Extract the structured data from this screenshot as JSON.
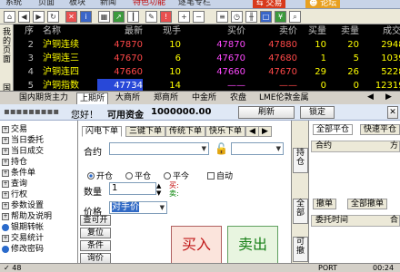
{
  "menu": {
    "items": [
      "系统",
      "页面",
      "板块",
      "新闻",
      "特色功能",
      "逐笔专栏"
    ],
    "trade": "交易",
    "forum": "论坛"
  },
  "side_strip": {
    "top": [
      "我",
      "的",
      "页",
      "面"
    ],
    "bottom": [
      "国",
      "内"
    ]
  },
  "quote_table": {
    "headers": {
      "seq": "序",
      "name": "名称",
      "last": "最新",
      "vol": "现手",
      "bid": "买价",
      "ask": "卖价",
      "bidq": "买量",
      "askq": "卖量",
      "total": "成交量"
    },
    "rows": [
      {
        "seq": "2",
        "name": "沪铜连续",
        "last": "47870",
        "vol": "10",
        "bid": "47870",
        "ask": "47880",
        "bidq": "10",
        "askq": "20",
        "total": "29482"
      },
      {
        "seq": "3",
        "name": "沪铜连三",
        "last": "47670",
        "vol": "6",
        "bid": "47670",
        "ask": "47680",
        "bidq": "1",
        "askq": "5",
        "total": "10398"
      },
      {
        "seq": "4",
        "name": "沪铜连四",
        "last": "47660",
        "vol": "10",
        "bid": "47660",
        "ask": "47670",
        "bidq": "29",
        "askq": "26",
        "total": "52288"
      },
      {
        "seq": "5",
        "name": "沪铜指数",
        "last": "47734",
        "vol": "14",
        "bid": "——",
        "ask": "——",
        "bidq": "0",
        "askq": "0",
        "total": "123190"
      }
    ]
  },
  "market_tabs": [
    "国内期货主力",
    "上期所",
    "大商所",
    "郑商所",
    "中金所",
    "农盘",
    "LME伦敦金属"
  ],
  "market_tabs_active": "上期所",
  "account": {
    "greeting": "您好！",
    "funds_label": "可用资金",
    "funds_value": "1000000.00",
    "refresh": "刷新",
    "lock": "锁定"
  },
  "tree": [
    {
      "icon": "+",
      "label": "交易"
    },
    {
      "icon": "+",
      "label": "当日委托"
    },
    {
      "icon": "+",
      "label": "当日成交"
    },
    {
      "icon": "+",
      "label": "持仓"
    },
    {
      "icon": "+",
      "label": "条件单"
    },
    {
      "icon": "+",
      "label": "查询"
    },
    {
      "icon": "+",
      "label": "行权"
    },
    {
      "icon": "+",
      "label": "参数设置"
    },
    {
      "icon": "+",
      "label": "帮助及说明"
    },
    {
      "icon": "dot",
      "label": "银期转帐"
    },
    {
      "icon": "+",
      "label": "交易统计"
    },
    {
      "icon": "dot",
      "label": "修改密码"
    }
  ],
  "order": {
    "tabs": [
      "闪电下单",
      "三键下单",
      "传统下单",
      "快乐下单"
    ],
    "contract_label": "合约",
    "open": "开仓",
    "close": "平仓",
    "close_today": "平今",
    "auto": "自动",
    "qty_label": "数量",
    "qty_value": "1",
    "buy_hint": "买:",
    "sell_hint": "卖:",
    "price_label": "价格",
    "price_value": "对手价",
    "buy": "买入",
    "sell": "卖出",
    "side_buttons": [
      "查可开",
      "复位",
      "条件",
      "询价"
    ]
  },
  "vbar": {
    "position": "持仓",
    "all": "全部",
    "cancelable": "可撤"
  },
  "right_panel": {
    "tabs_top": [
      "全部平仓",
      "快速平仓"
    ],
    "grid1_headers": [
      "合约",
      "方"
    ],
    "tabs_bottom": [
      "撤单",
      "全部撤单"
    ],
    "grid2_headers": [
      "委托时间",
      "合"
    ]
  },
  "status": {
    "left": "✓ 48",
    "mid": "PORT",
    "right": "00:24"
  }
}
